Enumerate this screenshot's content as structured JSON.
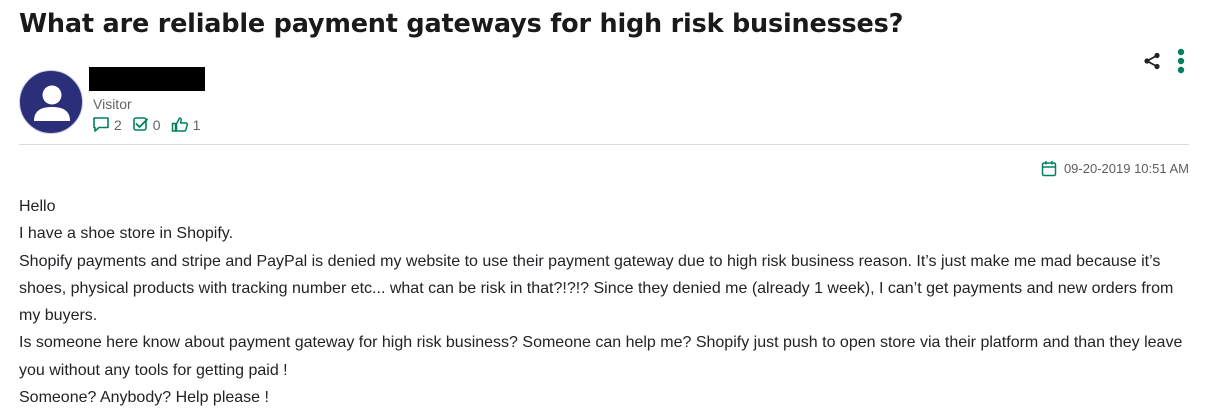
{
  "post": {
    "title": "What are reliable payment gateways for high risk businesses?",
    "author": {
      "role": "Visitor",
      "stats": {
        "messages": "2",
        "solutions": "0",
        "kudos": "1"
      }
    },
    "timestamp": "09-20-2019 10:51 AM",
    "body_lines": [
      "Hello",
      "I have a shoe store in Shopify.",
      "Shopify payments and stripe and PayPal is denied my website to use their payment gateway due to high risk business reason. It’s just make me mad because it’s shoes, physical products with tracking number etc... what can be risk in that?!?!? Since they denied me (already 1 week), I can’t get payments and new orders from my buyers.",
      "Is someone here know about payment gateway for high risk business? Someone can help me? Shopify just push to open store via their platform and than they leave you without any tools for getting paid !",
      "Someone? Anybody? Help please !"
    ]
  },
  "icons": {
    "share": "share-icon",
    "more": "more-vertical-icon",
    "messages": "speech-bubble-icon",
    "solutions": "checkbox-icon",
    "kudos": "thumbs-up-icon",
    "calendar": "calendar-icon"
  },
  "colors": {
    "accent": "#008060",
    "avatar_bg": "#2b2f79",
    "text": "#212326",
    "muted": "#616469",
    "divider": "#dcdcdc"
  }
}
